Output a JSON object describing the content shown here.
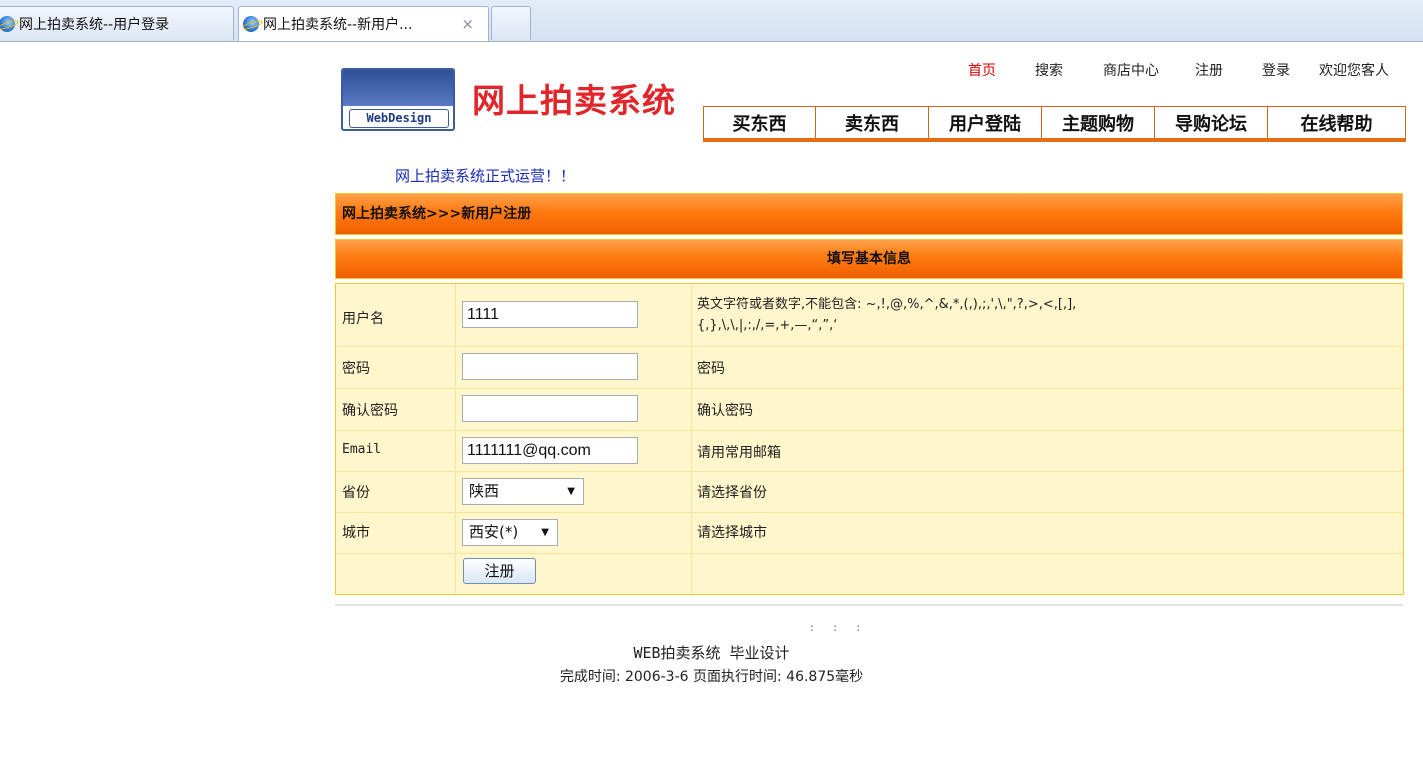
{
  "browser": {
    "tabs": [
      {
        "title": "网上拍卖系统--用户登录"
      },
      {
        "title": "网上拍卖系统--新用户...",
        "close": "×"
      }
    ]
  },
  "header": {
    "logo_text": "WebDesign",
    "site_title": "网上拍卖系统",
    "top_nav": [
      "首页",
      "搜索",
      "商店中心",
      "注册",
      "登录",
      "欢迎您客人"
    ],
    "main_nav": [
      "买东西",
      "卖东西",
      "用户登陆",
      "主题购物",
      "导购论坛",
      "在线帮助"
    ],
    "marquee": "网上拍卖系统正式运营！！"
  },
  "breadcrumb": "网上拍卖系统>>>新用户注册",
  "section_title": "填写基本信息",
  "form": {
    "username": {
      "label": "用户名",
      "value": "1111",
      "hint_line1": "英文字符或者数字,不能包含: ~,!,@,%,^,&,*,(,),;,',\\,\",?,>,<,[,],",
      "hint_line2": "{,},\\,\\,|,:,/,=,+,—,“,”,‘"
    },
    "password": {
      "label": "密码",
      "value": "",
      "hint": "密码"
    },
    "confirm": {
      "label": "确认密码",
      "value": "",
      "hint": "确认密码"
    },
    "email": {
      "label": "Email",
      "value": "1111111@qq.com",
      "hint": "请用常用邮箱"
    },
    "province": {
      "label": "省份",
      "selected": "陕西",
      "hint": "请选择省份"
    },
    "city": {
      "label": "城市",
      "selected": "西安(*)",
      "hint": "请选择城市"
    },
    "submit_label": "注册"
  },
  "footer": {
    "separators": ": : :",
    "line1": "WEB拍卖系统 毕业设计",
    "line2": "完成时间: 2006-3-6  页面执行时间: 46.875毫秒"
  }
}
